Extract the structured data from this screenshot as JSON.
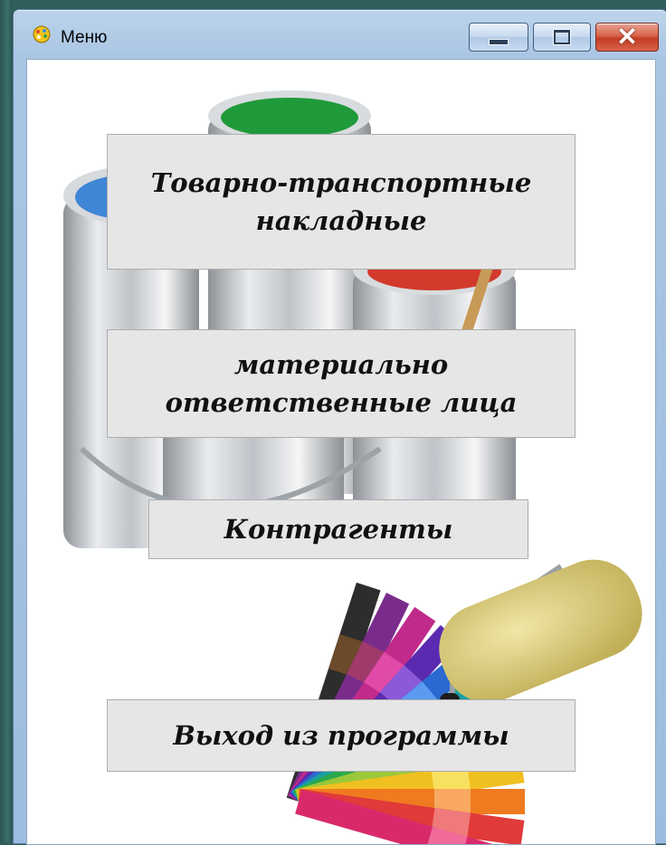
{
  "window": {
    "title": "Меню",
    "controls": [
      "minimize",
      "maximize",
      "close"
    ]
  },
  "menu": {
    "waybills_line1": "Товарно-транспортные",
    "waybills_line2": "накладные",
    "persons_line1": "материально",
    "persons_line2": "ответственные лица",
    "counterparties": "Контрагенты",
    "exit": "Выход из программы"
  },
  "background": {
    "description_icon": "paint-cans-palette-roller",
    "colors": {
      "green_paint": "#1f9a3a",
      "blue_paint": "#3f86d6",
      "red_paint": "#d23a2c",
      "roller": "#e2d58a"
    }
  }
}
